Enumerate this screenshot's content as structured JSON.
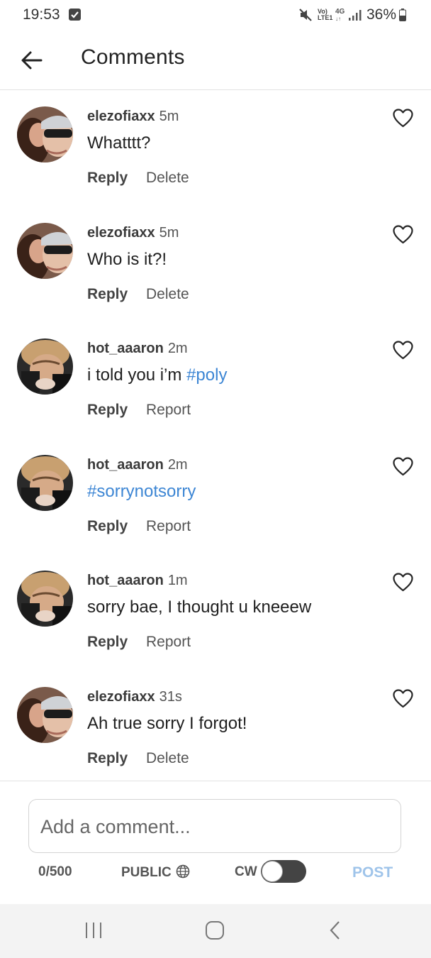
{
  "status_bar": {
    "time": "19:53",
    "network_volte": "Vo)",
    "network_lte": "LTE1",
    "network_type": "4G",
    "battery": "36%",
    "icons": [
      "checkbox-notification-icon",
      "mute-icon",
      "signal-icon",
      "battery-icon"
    ]
  },
  "header": {
    "back_icon": "arrow-left-icon",
    "title": "Comments"
  },
  "comments": [
    {
      "username": "elezofiaxx",
      "time": "5m",
      "text": "Whatttt?",
      "hashtag": "",
      "reply": "Reply",
      "action": "Delete",
      "avatar": "elezofiaxx"
    },
    {
      "username": "elezofiaxx",
      "time": "5m",
      "text": "Who is it?!",
      "hashtag": "",
      "reply": "Reply",
      "action": "Delete",
      "avatar": "elezofiaxx"
    },
    {
      "username": "hot_aaaron",
      "time": "2m",
      "text": "i told you i’m ",
      "hashtag": "#poly",
      "reply": "Reply",
      "action": "Report",
      "avatar": "hot_aaaron"
    },
    {
      "username": "hot_aaaron",
      "time": "2m",
      "text": "",
      "hashtag": "#sorrynotsorry",
      "reply": "Reply",
      "action": "Report",
      "avatar": "hot_aaaron"
    },
    {
      "username": "hot_aaaron",
      "time": "1m",
      "text": "sorry bae, I thought u kneeew",
      "hashtag": "",
      "reply": "Reply",
      "action": "Report",
      "avatar": "hot_aaaron"
    },
    {
      "username": "elezofiaxx",
      "time": "31s",
      "text": "Ah true sorry I forgot!",
      "hashtag": "",
      "reply": "Reply",
      "action": "Delete",
      "avatar": "elezofiaxx"
    }
  ],
  "composer": {
    "placeholder": "Add a comment...",
    "char_count": "0/500",
    "visibility": "PUBLIC",
    "cw_label": "CW",
    "cw_enabled": false,
    "post_label": "POST"
  },
  "nav_bar": {
    "icons": [
      "recents-icon",
      "home-icon",
      "back-icon"
    ]
  },
  "colors": {
    "hashtag": "#3d86d4",
    "post_disabled": "#9fc4ea",
    "toggle_track": "#444444"
  }
}
